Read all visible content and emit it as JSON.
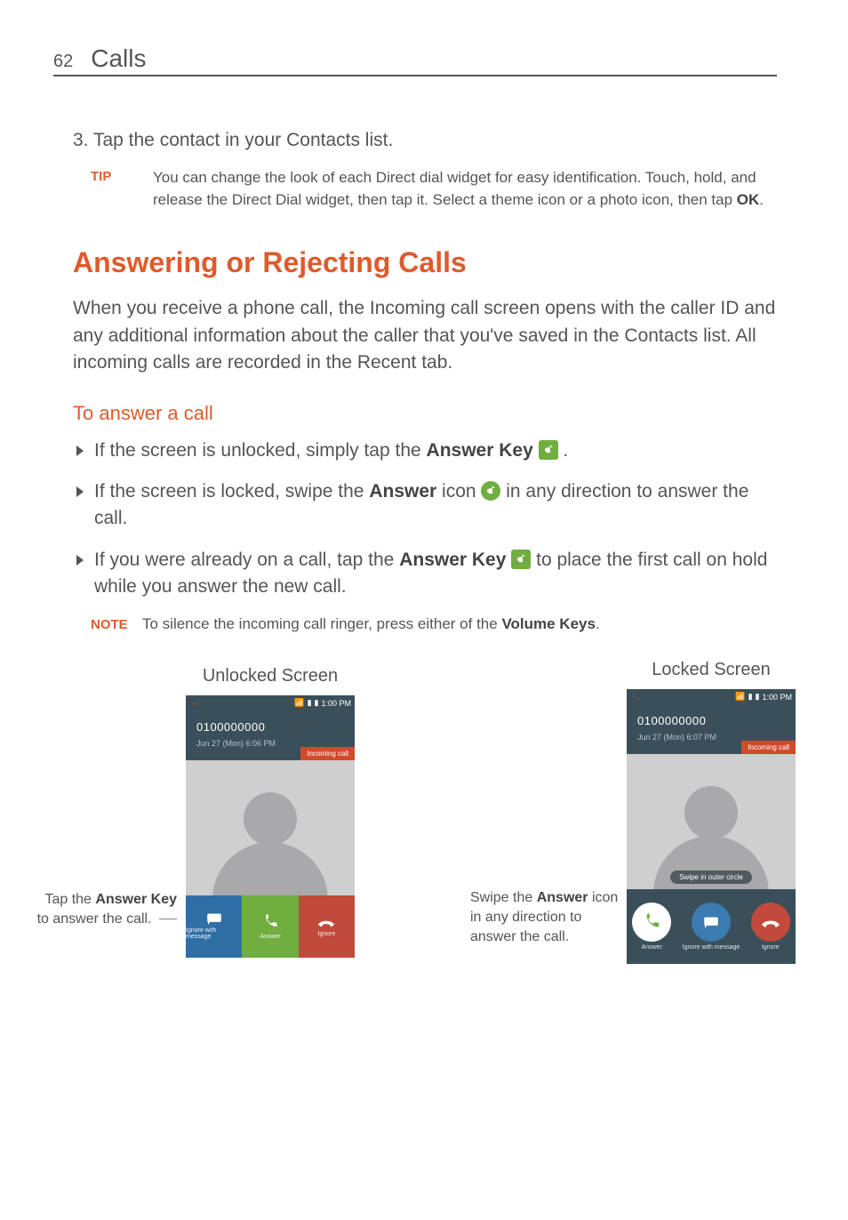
{
  "header": {
    "page_num": "62",
    "title": "Calls"
  },
  "step3": "3.  Tap the contact in your Contacts list.",
  "tip": {
    "label": "TIP",
    "text_before": "You can change the look of each Direct dial widget for easy identification. Touch, hold, and release the Direct Dial widget, then tap it. Select a theme icon or a photo icon, then tap ",
    "ok": "OK",
    "text_after": "."
  },
  "h2": "Answering or Rejecting Calls",
  "intro": "When you receive a phone call, the Incoming call screen opens with the caller ID and any additional information about the caller that you've saved in the Contacts list. All incoming calls are recorded in the Recent tab.",
  "h3": "To answer a call",
  "bullets": {
    "b1": {
      "pre": "If the screen is unlocked, simply tap the ",
      "key": "Answer Key",
      "post": " ."
    },
    "b2": {
      "pre": "If the screen is locked, swipe the ",
      "key": "Answer",
      "mid": " icon ",
      "post": " in any direction to answer the call."
    },
    "b3": {
      "pre": "If you were already on a call, tap the ",
      "key": "Answer Key",
      "post": " to place the first call on hold while you answer the new call."
    }
  },
  "note": {
    "label": "NOTE",
    "pre": "To silence the incoming call ringer, press either of the ",
    "key": "Volume Keys",
    "post": "."
  },
  "figures": {
    "unlocked_title": "Unlocked Screen",
    "locked_title": "Locked Screen",
    "left_caption_pre": "Tap the ",
    "left_caption_key": "Answer Key",
    "left_caption_post": " to answer the call.",
    "mid_caption_pre": "Swipe the ",
    "mid_caption_key": "Answer",
    "mid_caption_post": " icon in any direction to answer the call."
  },
  "phone": {
    "time": "1:00 PM",
    "number": "0100000000",
    "date1": "Jun 27 (Mon) 6:06 PM",
    "date2": "Jun 27 (Mon) 6:07 PM",
    "incoming": "Incoming call",
    "swipe_hint": "Swipe in outer circle",
    "btn_msg": "Ignore with message",
    "btn_answer": "Answer",
    "btn_ignore": "Ignore"
  }
}
